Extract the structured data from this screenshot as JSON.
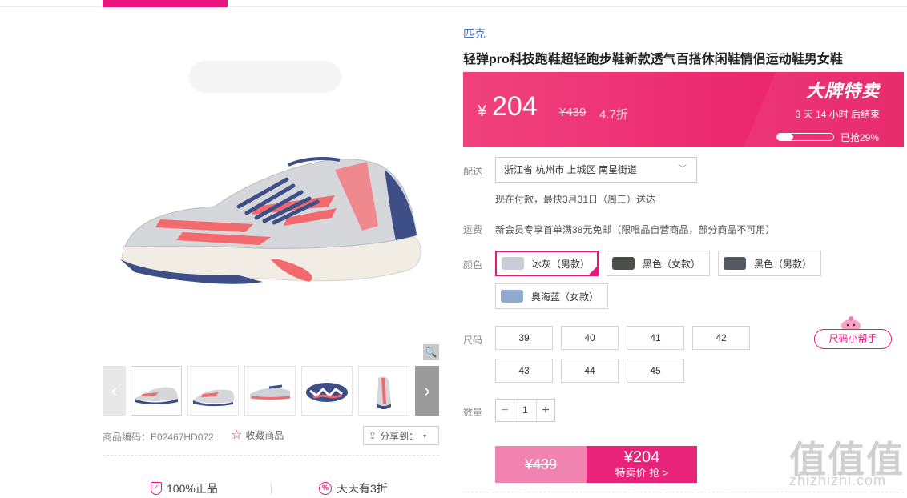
{
  "gallery": {
    "sku_code": "商品编码：E02467HD072",
    "favorite_label": "收藏商品",
    "share_label": "分享到：",
    "thumbnails": [
      "thumb-1",
      "thumb-2",
      "thumb-3",
      "thumb-4",
      "thumb-5"
    ]
  },
  "guarantees": {
    "authentic": "100%正品",
    "daily": "天天有3折"
  },
  "product": {
    "brand": "匹克",
    "title": "轻弹pro科技跑鞋超轻跑步鞋新款透气百搭休闲鞋情侣运动鞋男女鞋"
  },
  "price": {
    "currency": "¥",
    "current": "204",
    "original": "¥439",
    "discount": "4.7折",
    "sale_title": "大牌特卖",
    "countdown": "3  天  14  小时  后结束",
    "grabbed_text": "已抢29%",
    "grabbed_progress": 0.29
  },
  "delivery": {
    "label": "配送",
    "address": "浙江省 杭州市 上城区 南星街道",
    "arrive": "现在付款，最快3月31日（周三）送达"
  },
  "shipping": {
    "label": "运费",
    "text": "新会员专享首单满38元免邮（限唯品自营商品，部分商品不可用）"
  },
  "colors": {
    "label": "颜色",
    "options": [
      {
        "label": "冰灰（男款）",
        "swatch": "#c9cdd6",
        "selected": true
      },
      {
        "label": "黑色（女款）",
        "swatch": "#4a4f4a",
        "selected": false
      },
      {
        "label": "黑色（男款）",
        "swatch": "#555a60",
        "selected": false
      },
      {
        "label": "奥海蓝（女款）",
        "swatch": "#8fa8cf",
        "selected": false
      }
    ]
  },
  "sizes": {
    "label": "尺码",
    "options": [
      "39",
      "40",
      "41",
      "42",
      "43",
      "44",
      "45"
    ],
    "helper": "尺码小帮手"
  },
  "quantity": {
    "label": "数量",
    "value": "1",
    "minus": "−",
    "plus": "+"
  },
  "buy": {
    "original": "¥439",
    "price": "¥204",
    "action": "特卖价 抢 >"
  },
  "watermark": {
    "big": "值值值",
    "small": "zhizhizhi.com"
  },
  "colors_theme": {
    "accent": "#e8157e",
    "brand_link": "#4a6fc7"
  }
}
